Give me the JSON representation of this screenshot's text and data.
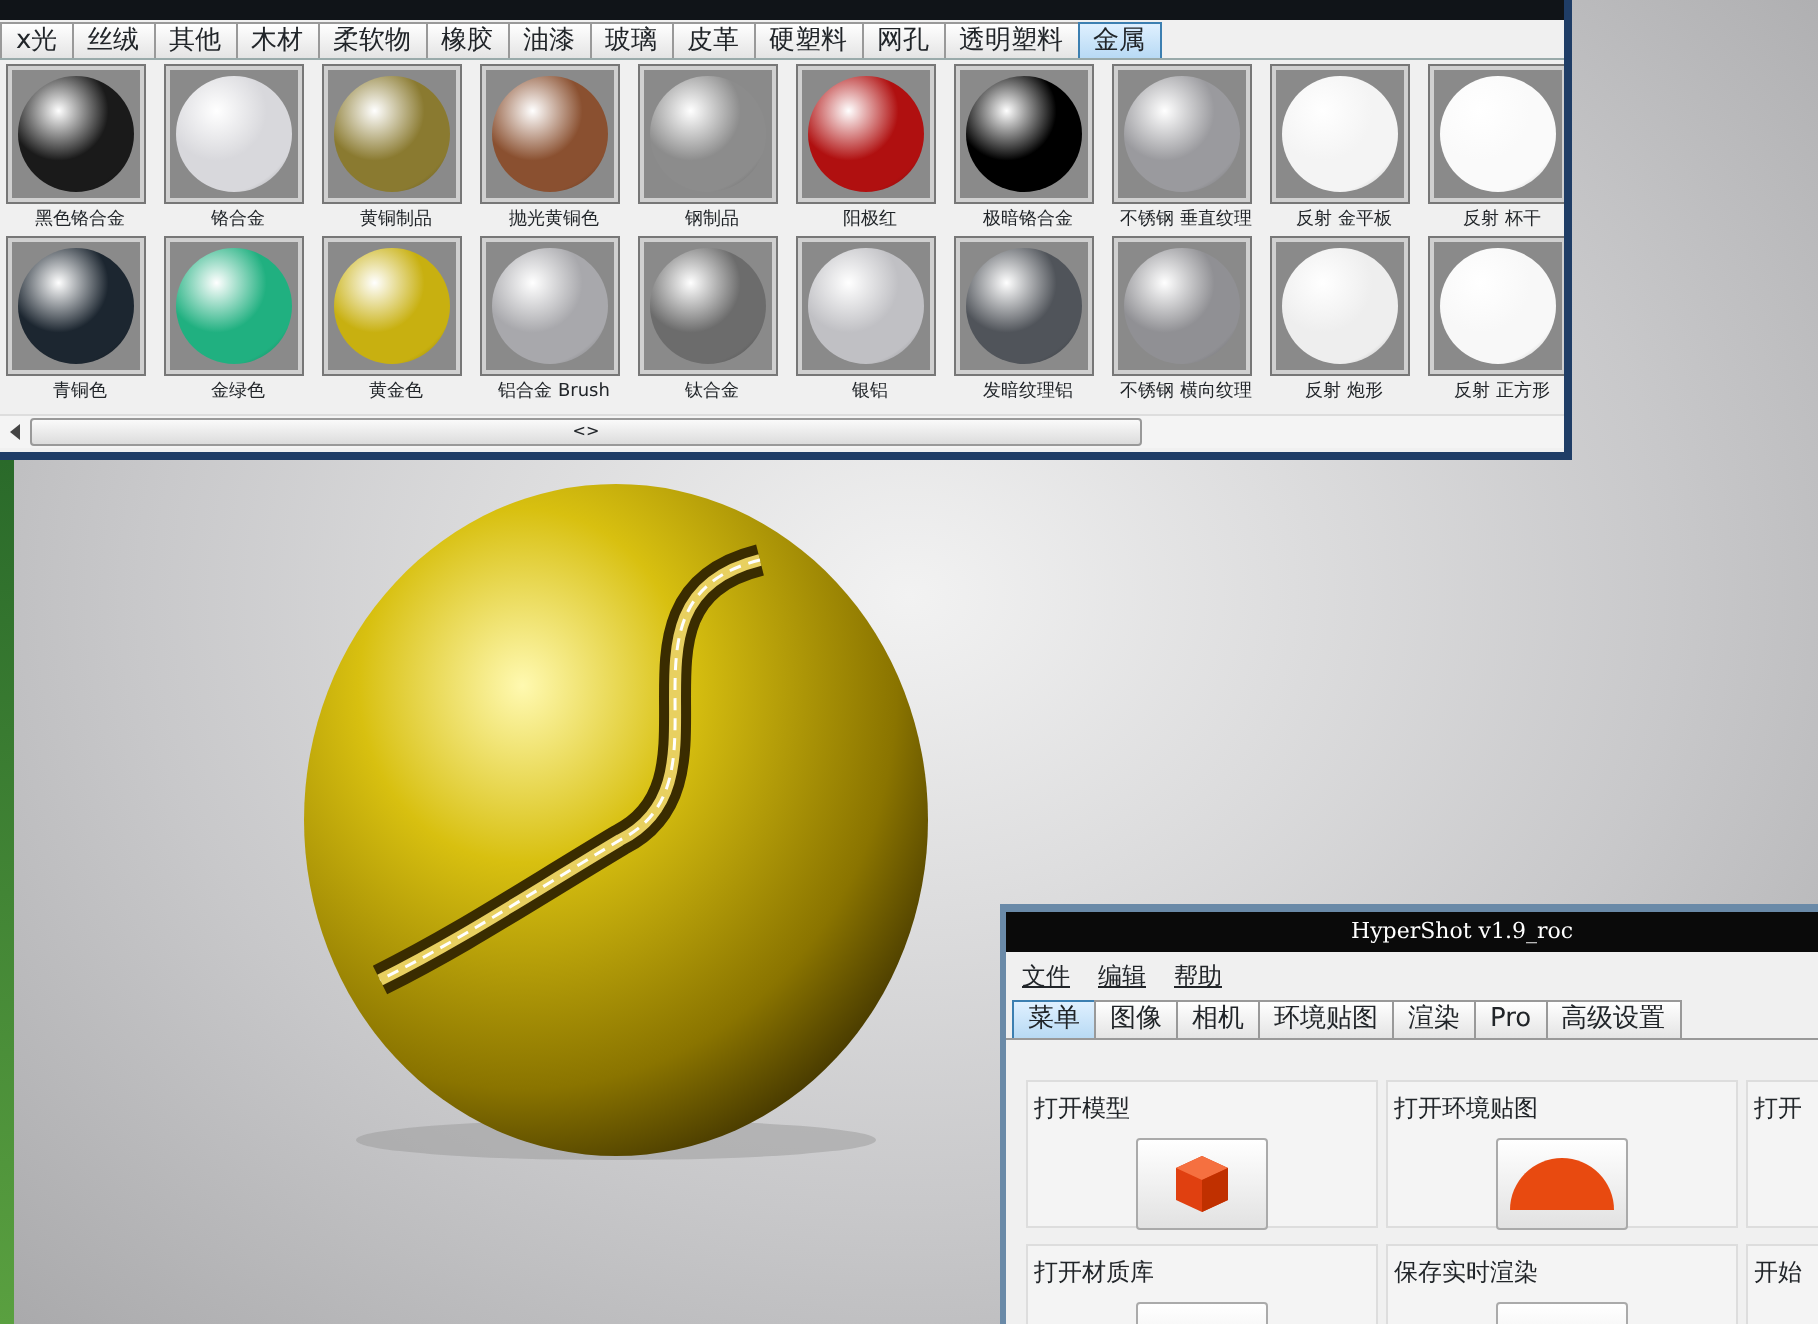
{
  "material_library": {
    "tabs": [
      {
        "label": "x光",
        "selected": false
      },
      {
        "label": "丝绒",
        "selected": false
      },
      {
        "label": "其他",
        "selected": false
      },
      {
        "label": "木材",
        "selected": false
      },
      {
        "label": "柔软物",
        "selected": false
      },
      {
        "label": "橡胶",
        "selected": false
      },
      {
        "label": "油漆",
        "selected": false
      },
      {
        "label": "玻璃",
        "selected": false
      },
      {
        "label": "皮革",
        "selected": false
      },
      {
        "label": "硬塑料",
        "selected": false
      },
      {
        "label": "网孔",
        "selected": false
      },
      {
        "label": "透明塑料",
        "selected": false
      },
      {
        "label": "金属",
        "selected": true
      }
    ],
    "swatches": [
      {
        "label": "黑色铬合金",
        "color": "#1a1a1a"
      },
      {
        "label": "铬合金",
        "color": "#d8d8dc"
      },
      {
        "label": "黄铜制品",
        "color": "#8a7a30"
      },
      {
        "label": "抛光黄铜色",
        "color": "#8a5030"
      },
      {
        "label": "钢制品",
        "color": "#8c8c8c"
      },
      {
        "label": "阳极红",
        "color": "#b01010"
      },
      {
        "label": "极暗铬合金",
        "color": "#000000"
      },
      {
        "label": "不锈钢 垂直纹理",
        "color": "#9a9a9e"
      },
      {
        "label": "反射 金平板",
        "color": "#f4f4f4"
      },
      {
        "label": "反射 杯干",
        "color": "#fafafa"
      },
      {
        "label": "青铜色",
        "color": "#1c2630"
      },
      {
        "label": "金绿色",
        "color": "#20b080"
      },
      {
        "label": "黄金色",
        "color": "#c8b010"
      },
      {
        "label": "铝合金 Brush",
        "color": "#a8a8ac"
      },
      {
        "label": "钛合金",
        "color": "#6c6c6c"
      },
      {
        "label": "银铝",
        "color": "#c0c0c4"
      },
      {
        "label": "发暗纹理铝",
        "color": "#50545a"
      },
      {
        "label": "不锈钢 横向纹理",
        "color": "#909094"
      },
      {
        "label": "反射 炮形",
        "color": "#eeeeee"
      },
      {
        "label": "反射 正方形",
        "color": "#f8f8f8"
      }
    ],
    "scrollbar_label": "<>"
  },
  "hypershot": {
    "title": "HyperShot v1.9_roc",
    "menu": [
      "文件",
      "编辑",
      "帮助"
    ],
    "tabs": [
      {
        "label": "菜单",
        "selected": true
      },
      {
        "label": "图像",
        "selected": false
      },
      {
        "label": "相机",
        "selected": false
      },
      {
        "label": "环境贴图",
        "selected": false
      },
      {
        "label": "渲染",
        "selected": false
      },
      {
        "label": "Pro",
        "selected": false
      },
      {
        "label": "高级设置",
        "selected": false
      }
    ],
    "groups": [
      {
        "title": "打开模型",
        "kind": "cube"
      },
      {
        "title": "打开环境贴图",
        "kind": "dome"
      },
      {
        "title": "打开",
        "kind": "none"
      },
      {
        "title": "打开材质库",
        "kind": "plain"
      },
      {
        "title": "保存实时渲染",
        "kind": "plain"
      },
      {
        "title": "开始",
        "kind": "none"
      }
    ]
  }
}
